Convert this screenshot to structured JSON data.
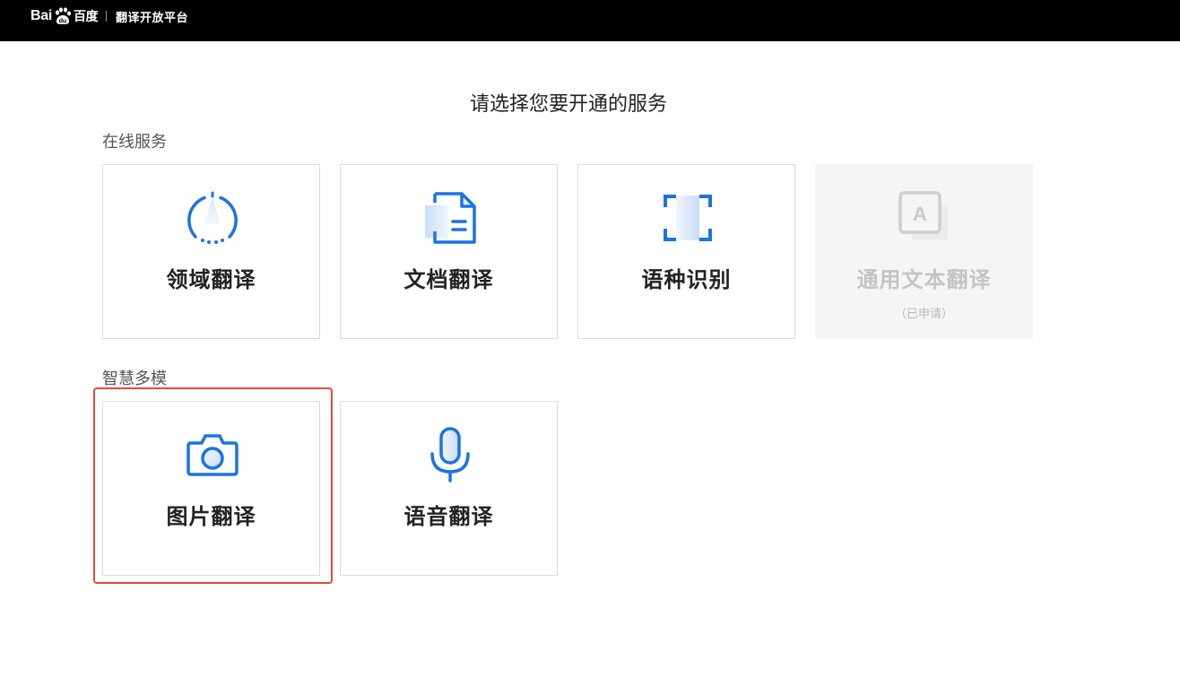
{
  "header": {
    "logo_latin": "Bai",
    "logo_cn": "百度",
    "platform_name": "翻译开放平台",
    "logo_icon": "baidu-paw-icon"
  },
  "page": {
    "title": "请选择您要开通的服务"
  },
  "sections": [
    {
      "title": "在线服务",
      "cards": [
        {
          "label": "领域翻译",
          "icon": "domain-translation-icon",
          "enabled": true
        },
        {
          "label": "文档翻译",
          "icon": "document-icon",
          "enabled": true
        },
        {
          "label": "语种识别",
          "icon": "language-detection-icon",
          "enabled": true
        },
        {
          "label": "通用文本翻译",
          "sublabel": "（已申请）",
          "icon": "text-translation-icon",
          "enabled": false
        }
      ]
    },
    {
      "title": "智慧多模",
      "cards": [
        {
          "label": "图片翻译",
          "icon": "camera-icon",
          "enabled": true,
          "highlighted": true
        },
        {
          "label": "语音翻译",
          "icon": "microphone-icon",
          "enabled": true
        }
      ]
    }
  ],
  "colors": {
    "accent": "#1a73e8",
    "highlight_border": "#e84a36",
    "header_bg": "#000000",
    "disabled_bg": "#f5f5f5"
  }
}
